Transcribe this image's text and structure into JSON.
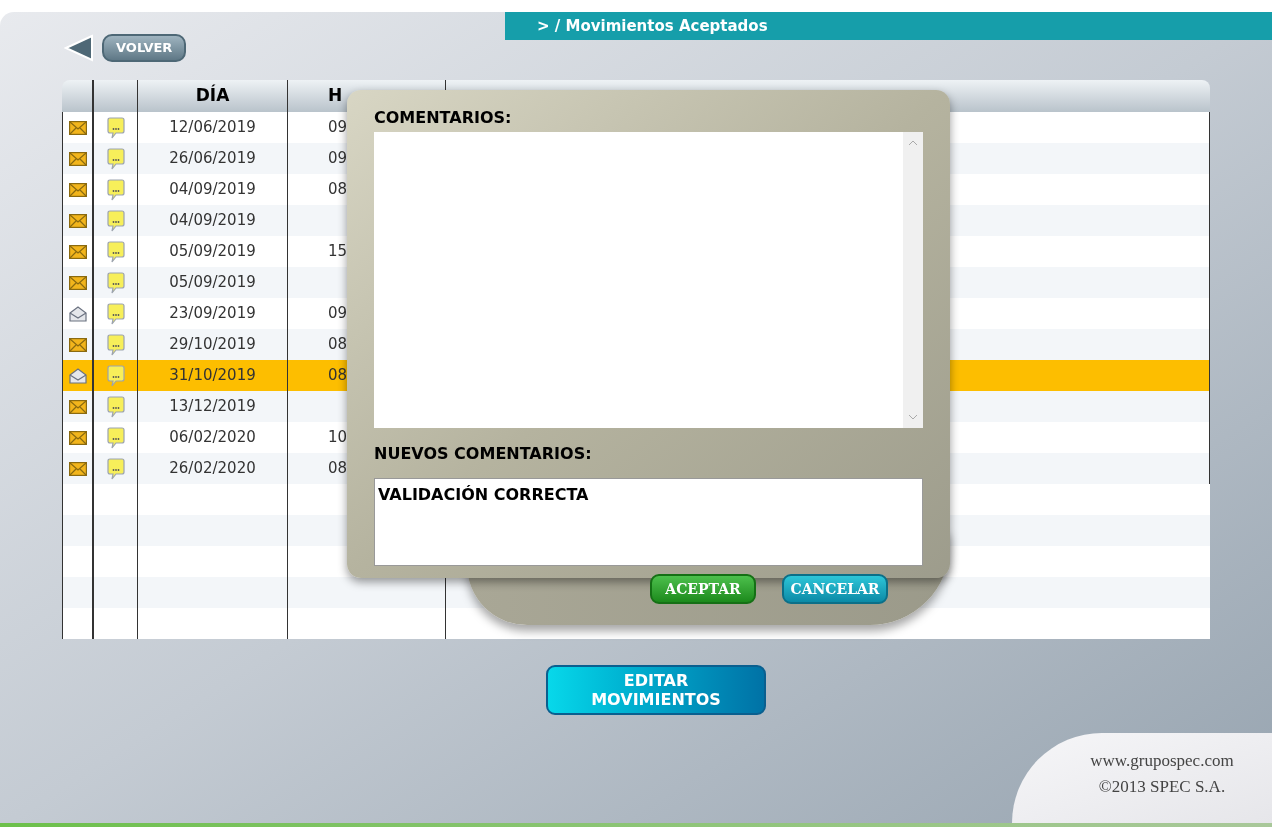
{
  "breadcrumb": "> / Movimientos Aceptados",
  "back_button": "VOLVER",
  "table": {
    "columns": [
      "DÍA",
      "H"
    ],
    "rows": [
      {
        "read": false,
        "day": "12/06/2019",
        "hour": "09",
        "selected": false
      },
      {
        "read": false,
        "day": "26/06/2019",
        "hour": "09",
        "selected": false
      },
      {
        "read": false,
        "day": "04/09/2019",
        "hour": "08",
        "selected": false
      },
      {
        "read": false,
        "day": "04/09/2019",
        "hour": "",
        "selected": false
      },
      {
        "read": false,
        "day": "05/09/2019",
        "hour": "15",
        "selected": false
      },
      {
        "read": false,
        "day": "05/09/2019",
        "hour": "",
        "selected": false
      },
      {
        "read": true,
        "day": "23/09/2019",
        "hour": "09",
        "selected": false
      },
      {
        "read": false,
        "day": "29/10/2019",
        "hour": "08",
        "selected": false
      },
      {
        "read": true,
        "day": "31/10/2019",
        "hour": "08",
        "selected": true
      },
      {
        "read": false,
        "day": "13/12/2019",
        "hour": "",
        "selected": false
      },
      {
        "read": false,
        "day": "06/02/2020",
        "hour": "10",
        "selected": false
      },
      {
        "read": false,
        "day": "26/02/2020",
        "hour": "08",
        "selected": false
      }
    ]
  },
  "dialog": {
    "comments_label": "COMENTARIOS:",
    "new_comments_label": "NUEVOS COMENTARIOS:",
    "new_comments_value": "VALIDACIÓN CORRECTA",
    "accept": "ACEPTAR",
    "cancel": "CANCELAR"
  },
  "edit_button": [
    "EDITAR",
    "MOVIMIENTOS"
  ],
  "footer": {
    "website": "www.grupospec.com",
    "copyright": "©2013 SPEC S.A."
  }
}
